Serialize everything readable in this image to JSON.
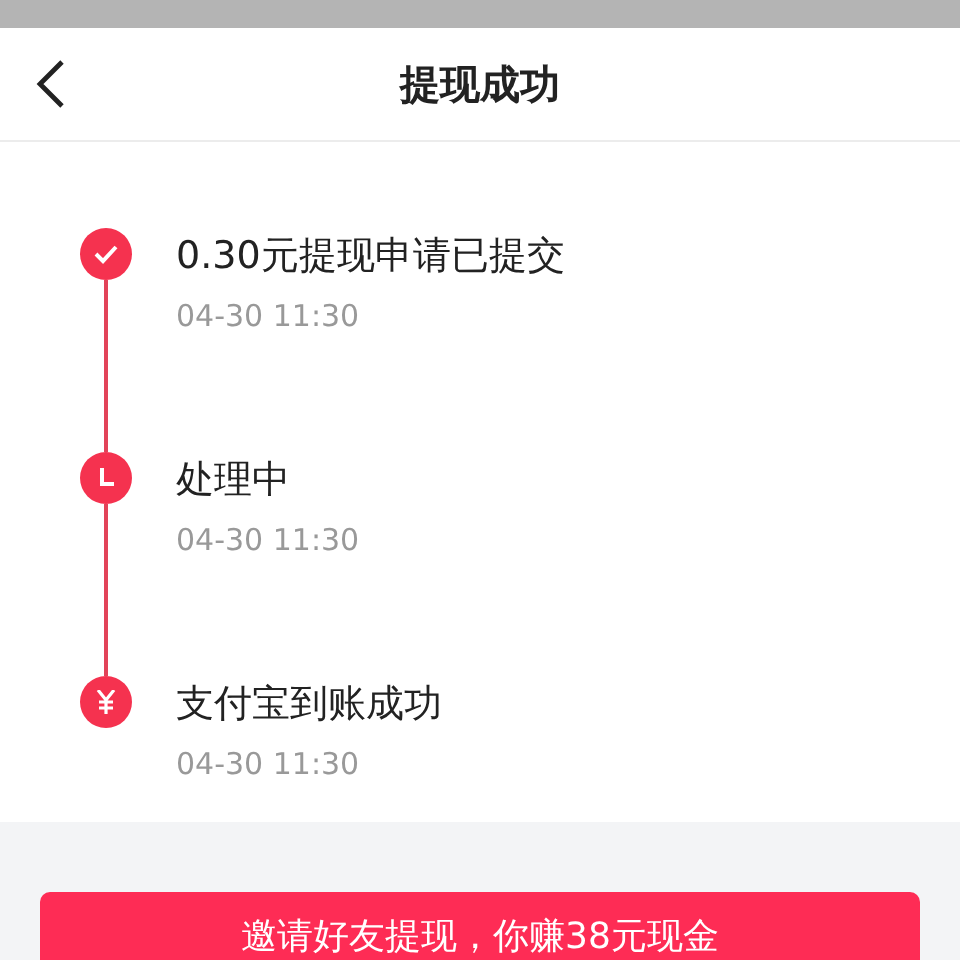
{
  "header": {
    "title": "提现成功"
  },
  "steps": [
    {
      "kind": "check",
      "title": "0.30元提现申请已提交",
      "time": "04-30 11:30"
    },
    {
      "kind": "clock",
      "title": "处理中",
      "time": "04-30 11:30"
    },
    {
      "kind": "yen",
      "title": "支付宝到账成功",
      "time": "04-30 11:30"
    }
  ],
  "invite_button": "邀请好友提现，你赚38元现金"
}
